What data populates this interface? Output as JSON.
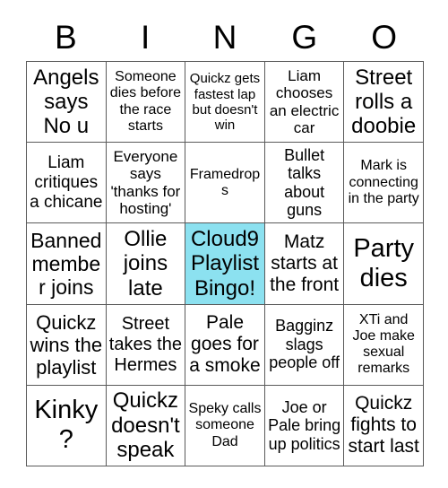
{
  "title": "BINGO",
  "header": {
    "letters": [
      "B",
      "I",
      "N",
      "G",
      "O"
    ]
  },
  "colors": {
    "marked_cell": "#8CE1F0",
    "grid_line": "#5A5A5A",
    "cell_background": "#FFFFFF",
    "text": "#000000"
  },
  "grid": {
    "columns": 5,
    "rows": 5,
    "free_space_index": 12,
    "cells": [
      {
        "text": "Angels says No u",
        "marked": false,
        "size": "xl"
      },
      {
        "text": "Someone dies before the race starts",
        "marked": false,
        "size": "sm"
      },
      {
        "text": "Quickz gets fastest lap but doesn't win",
        "marked": false,
        "size": "sm"
      },
      {
        "text": "Liam chooses an electric car",
        "marked": false,
        "size": "md"
      },
      {
        "text": "Street rolls a doobie",
        "marked": false,
        "size": "xl"
      },
      {
        "text": "Liam critiques a chicane",
        "marked": false,
        "size": "lg"
      },
      {
        "text": "Everyone says 'thanks for hosting'",
        "marked": false,
        "size": "md"
      },
      {
        "text": "Framedrops",
        "marked": false,
        "size": "sm"
      },
      {
        "text": "Bullet talks about guns",
        "marked": false,
        "size": "lg"
      },
      {
        "text": "Mark is connecting in the party",
        "marked": false,
        "size": "sm"
      },
      {
        "text": "Banned member joins",
        "marked": false,
        "size": "xl"
      },
      {
        "text": "Ollie joins late",
        "marked": false,
        "size": "xl"
      },
      {
        "text": "Cloud9 Playlist Bingo!",
        "marked": true,
        "size": "xl"
      },
      {
        "text": "Matz starts at the front",
        "marked": false,
        "size": "lg"
      },
      {
        "text": "Party dies",
        "marked": false,
        "size": "xxl"
      },
      {
        "text": "Quickz wins the playlist",
        "marked": false,
        "size": "xl"
      },
      {
        "text": "Street takes the Hermes",
        "marked": false,
        "size": "lg"
      },
      {
        "text": "Pale goes for a smoke",
        "marked": false,
        "size": "xl"
      },
      {
        "text": "Bagginz slags people off",
        "marked": false,
        "size": "md"
      },
      {
        "text": "XTi and Joe make sexual remarks",
        "marked": false,
        "size": "sm"
      },
      {
        "text": "Kinky?",
        "marked": false,
        "size": "xxl"
      },
      {
        "text": "Quickz doesn't speak",
        "marked": false,
        "size": "xl"
      },
      {
        "text": "Speky calls someone Dad",
        "marked": false,
        "size": "sm"
      },
      {
        "text": "Joe or Pale bring up politics",
        "marked": false,
        "size": "md"
      },
      {
        "text": "Quickz fights to start last",
        "marked": false,
        "size": "lg"
      }
    ]
  }
}
